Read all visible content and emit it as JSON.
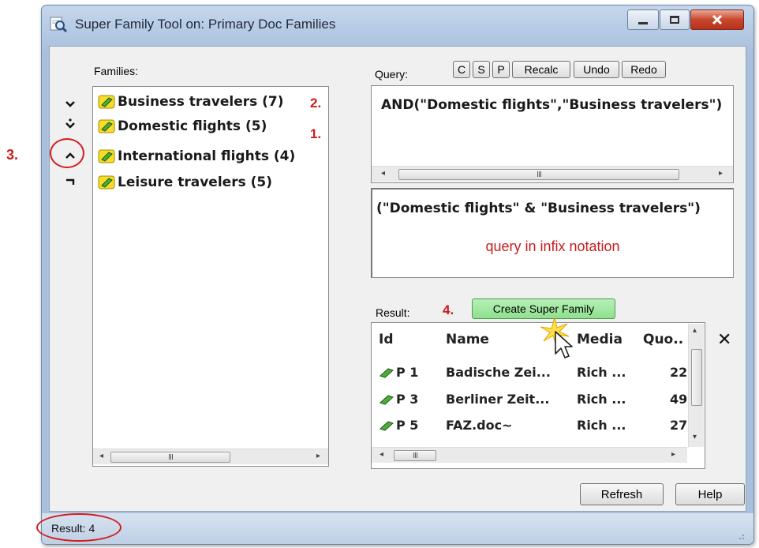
{
  "window": {
    "title": "Super Family Tool on: Primary Doc Families"
  },
  "families": {
    "label": "Families:",
    "items": [
      {
        "label": "Business travelers (7)",
        "annotation": "2."
      },
      {
        "label": "Domestic flights (5)",
        "annotation": "1."
      },
      {
        "label": "International flights (4)",
        "annotation": ""
      },
      {
        "label": "Leisure travelers (5)",
        "annotation": ""
      }
    ],
    "scroll_glyph": "III",
    "side_annotation": "3."
  },
  "query": {
    "label": "Query:",
    "buttons": [
      "C",
      "S",
      "P",
      "Recalc",
      "Undo",
      "Redo"
    ],
    "text": "AND(\"Domestic flights\",\"Business travelers\")",
    "scroll_glyph": "III",
    "infix_text": "(\"Domestic flights\" & \"Business travelers\")",
    "infix_note": "query in infix notation"
  },
  "result": {
    "label": "Result:",
    "annotation": "4.",
    "create_button": "Create Super Family",
    "columns": [
      "Id",
      "Name",
      "Media",
      "Quo.."
    ],
    "rows": [
      {
        "id": "P 1",
        "name": "Badische Zei...",
        "media": "Rich ...",
        "quo": "22"
      },
      {
        "id": "P 3",
        "name": "Berliner Zeit...",
        "media": "Rich ...",
        "quo": "49"
      },
      {
        "id": "P 5",
        "name": "FAZ.doc~",
        "media": "Rich ...",
        "quo": "27"
      }
    ],
    "scroll_glyph": "III",
    "close_glyph": "✕"
  },
  "footer": {
    "refresh": "Refresh",
    "help": "Help",
    "status": "Result: 4"
  },
  "colors": {
    "annotation_red": "#c91d1d",
    "create_button_green": "#8fe08f",
    "titlebar_blue": "#b6cbe4"
  }
}
